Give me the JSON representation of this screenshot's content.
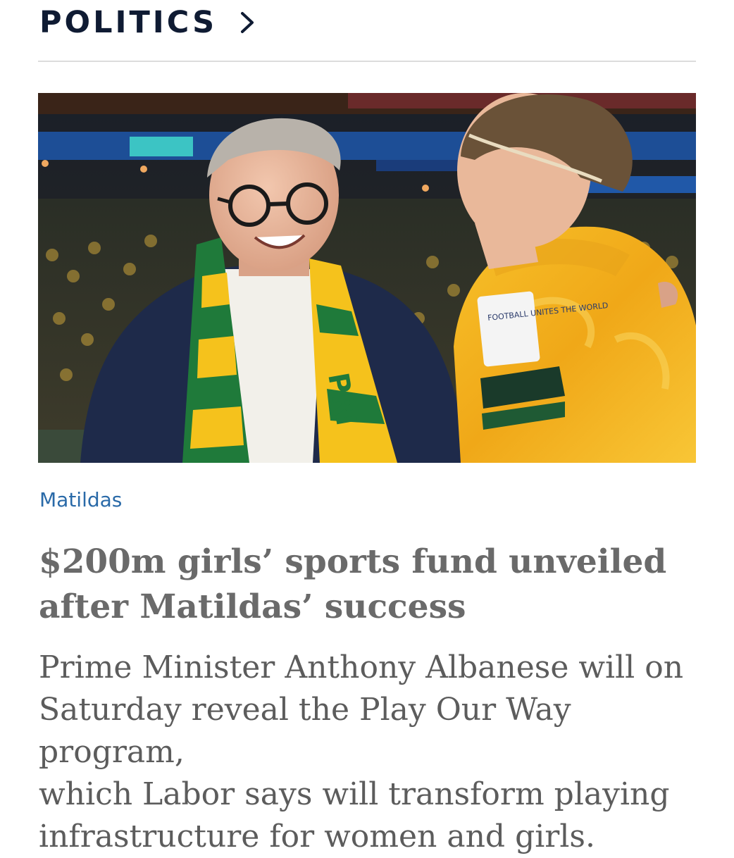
{
  "section": {
    "title": "POLITICS",
    "chevron_icon": "chevron-right-icon"
  },
  "article": {
    "tag": "Matildas",
    "headline_line1": "$200m girls’ sports fund unveiled",
    "headline_line2": "after Matildas’ success",
    "standfirst_line1": "Prime Minister Anthony Albanese will on",
    "standfirst_line2": "Saturday reveal the Play Our Way program,",
    "standfirst_line3": "which Labor says will transform playing",
    "standfirst_line4": "infrastructure for women and girls.",
    "image": {
      "scarf_text": "PRI",
      "patch_text": "FOOTBALL UNITES THE WORLD"
    }
  },
  "colors": {
    "section_title": "#0f1b33",
    "tag": "#2a6aa8",
    "headline": "#6a6a6a",
    "standfirst": "#5c5c5c",
    "divider": "#dcdcdc",
    "jersey": "#f5b81c",
    "scarf_green": "#1f7a3a"
  }
}
